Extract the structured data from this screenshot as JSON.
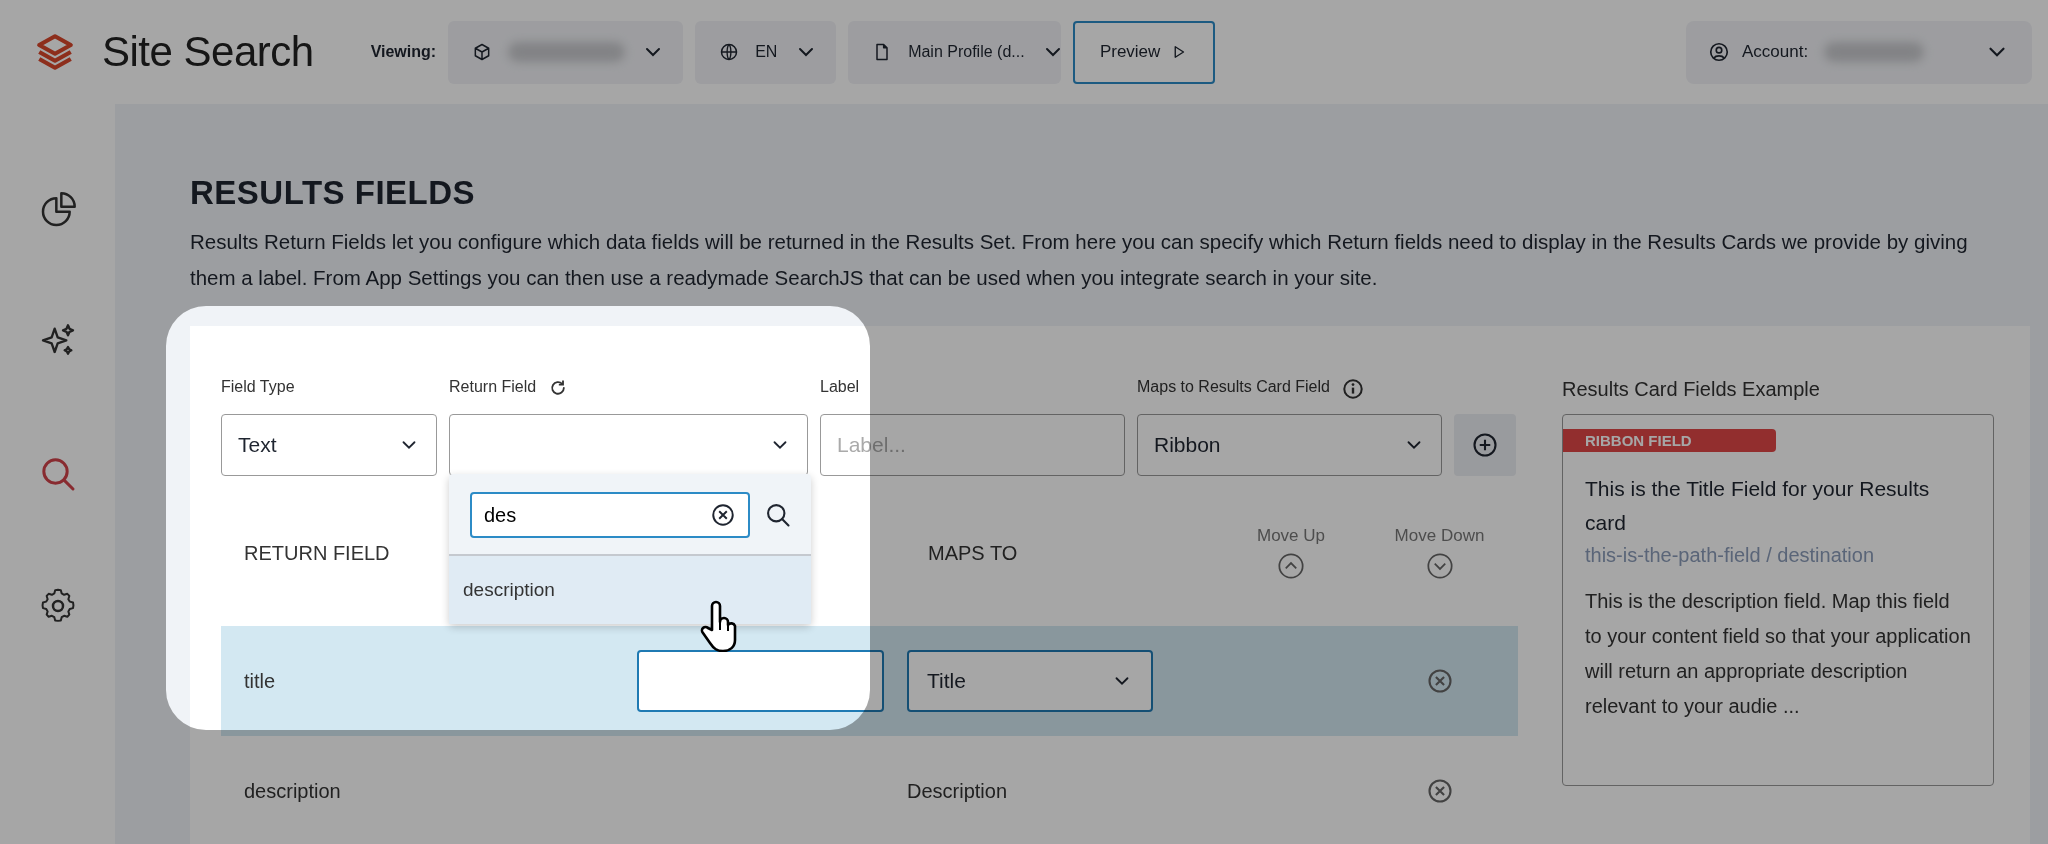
{
  "header": {
    "app_title": "Site Search",
    "viewing_label": "Viewing:",
    "selectors": [
      {
        "kind": "project"
      },
      {
        "kind": "language",
        "value": "EN"
      },
      {
        "kind": "profile",
        "value": "Main Profile (d..."
      }
    ],
    "preview_button": "Preview",
    "account": {
      "label": "Account:"
    }
  },
  "sidebar": {
    "items": [
      {
        "kind": "analytics",
        "selected": false
      },
      {
        "kind": "ai",
        "selected": false
      },
      {
        "kind": "search",
        "selected": true
      },
      {
        "kind": "settings",
        "selected": false
      }
    ]
  },
  "page": {
    "title": "RESULTS FIELDS",
    "description": "Results Return Fields let you configure which data fields will be returned in the Results Set. From here you can specify which Return fields need to display in the Results Cards we provide by giving them a label. From App Settings you can then use a readymade SearchJS that can be used when you integrate search in your site."
  },
  "form": {
    "field_type": {
      "label": "Field Type",
      "value": "Text"
    },
    "return_field": {
      "label": "Return Field"
    },
    "label": {
      "label": "Label",
      "placeholder": "Label..."
    },
    "maps_to": {
      "label": "Maps to Results Card Field",
      "value": "Ribbon"
    }
  },
  "return_field_dropdown": {
    "search_value": "des",
    "options": [
      {
        "label": "description",
        "selected": true
      }
    ]
  },
  "table": {
    "columns": [
      "RETURN FIELD",
      "MAPS TO",
      "Move Up",
      "Move Down"
    ],
    "rows": [
      {
        "return_field": "title",
        "maps_to": "Title",
        "editing": true,
        "selected": true
      },
      {
        "return_field": "description",
        "maps_to": "Description",
        "editing": false,
        "selected": false
      }
    ]
  },
  "example": {
    "title": "Results Card Fields Example",
    "ribbon": "RIBBON FIELD",
    "card_title": "This is the Title Field for your Results card",
    "path": "this-is-the-path-field / destination",
    "description": "This is the description field. Map this field to your content field so that your application will return an appropriate description relevant to your audie ..."
  }
}
